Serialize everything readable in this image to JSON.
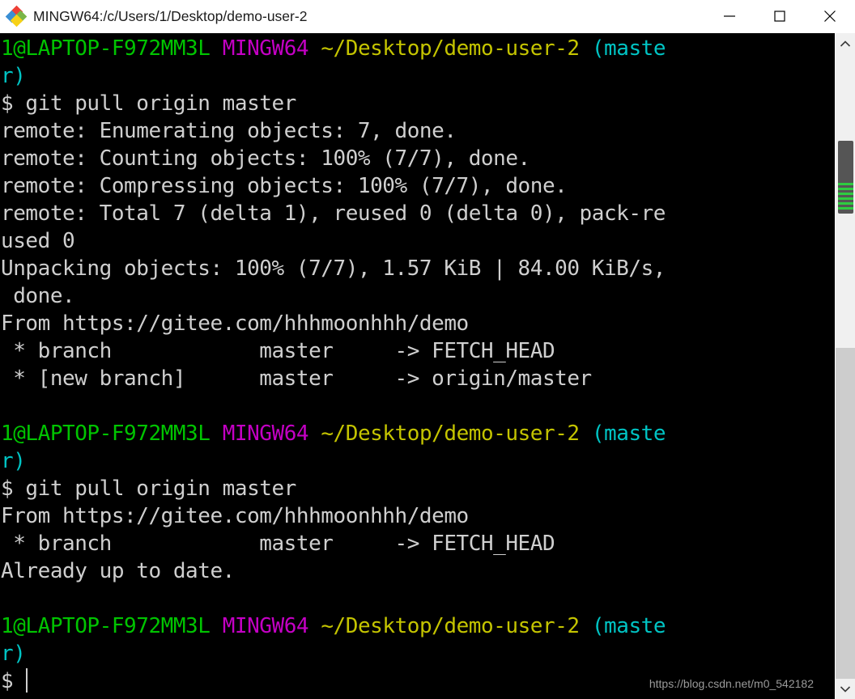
{
  "window": {
    "title": "MINGW64:/c/Users/1/Desktop/demo-user-2",
    "icon": "git-bash-diamond-icon",
    "controls": {
      "minimize": "minimize-icon",
      "maximize": "maximize-icon",
      "close": "close-icon"
    }
  },
  "theme": {
    "background": "#000000",
    "foreground": "#c8c8c8",
    "green": "#00c400",
    "magenta": "#c400c4",
    "yellow": "#c4c400",
    "cyan": "#00c4c4",
    "titlebar_bg": "#ffffff",
    "scrollbar_track": "#f0f0f0",
    "scrollbar_thumb": "#555555",
    "scrollbar_thumb_stripe": "#2ecc40"
  },
  "prompt": {
    "user_host": "1@LAPTOP-F972MM3L",
    "shell": "MINGW64",
    "path": "~/Desktop/demo-user-2",
    "branch_open": "(maste",
    "branch_wrap": "r)",
    "sigil": "$"
  },
  "terminal": {
    "lines": [
      {
        "id": "prompt-1-line-1",
        "segments": [
          {
            "text": "1@LAPTOP-F972MM3L",
            "color": "green"
          },
          {
            "text": " ",
            "color": "white"
          },
          {
            "text": "MINGW64",
            "color": "magenta"
          },
          {
            "text": " ",
            "color": "white"
          },
          {
            "text": "~/Desktop/demo-user-2",
            "color": "yellow"
          },
          {
            "text": " ",
            "color": "white"
          },
          {
            "text": "(maste",
            "color": "cyan"
          }
        ]
      },
      {
        "id": "prompt-1-line-2",
        "segments": [
          {
            "text": "r)",
            "color": "cyan"
          }
        ]
      },
      {
        "id": "command-1",
        "segments": [
          {
            "text": "$ git pull origin master",
            "color": "white"
          }
        ]
      },
      {
        "id": "output-enumerating",
        "segments": [
          {
            "text": "remote: Enumerating objects: 7, done.",
            "color": "white"
          }
        ]
      },
      {
        "id": "output-counting",
        "segments": [
          {
            "text": "remote: Counting objects: 100% (7/7), done.",
            "color": "white"
          }
        ]
      },
      {
        "id": "output-compressing",
        "segments": [
          {
            "text": "remote: Compressing objects: 100% (7/7), done.",
            "color": "white"
          }
        ]
      },
      {
        "id": "output-total-line-1",
        "segments": [
          {
            "text": "remote: Total 7 (delta 1), reused 0 (delta 0), pack-re",
            "color": "white"
          }
        ]
      },
      {
        "id": "output-total-line-2",
        "segments": [
          {
            "text": "used 0",
            "color": "white"
          }
        ]
      },
      {
        "id": "output-unpacking-line-1",
        "segments": [
          {
            "text": "Unpacking objects: 100% (7/7), 1.57 KiB | 84.00 KiB/s,",
            "color": "white"
          }
        ]
      },
      {
        "id": "output-unpacking-line-2",
        "segments": [
          {
            "text": " done.",
            "color": "white"
          }
        ]
      },
      {
        "id": "output-from-1",
        "segments": [
          {
            "text": "From https://gitee.com/hhhmoonhhh/demo",
            "color": "white"
          }
        ]
      },
      {
        "id": "output-branch-fetchhead-1",
        "segments": [
          {
            "text": " * branch            master     -> FETCH_HEAD",
            "color": "white"
          }
        ]
      },
      {
        "id": "output-new-branch",
        "segments": [
          {
            "text": " * [new branch]      master     -> origin/master",
            "color": "white"
          }
        ]
      },
      {
        "id": "blank-1",
        "segments": [
          {
            "text": "",
            "color": "white"
          }
        ]
      },
      {
        "id": "prompt-2-line-1",
        "segments": [
          {
            "text": "1@LAPTOP-F972MM3L",
            "color": "green"
          },
          {
            "text": " ",
            "color": "white"
          },
          {
            "text": "MINGW64",
            "color": "magenta"
          },
          {
            "text": " ",
            "color": "white"
          },
          {
            "text": "~/Desktop/demo-user-2",
            "color": "yellow"
          },
          {
            "text": " ",
            "color": "white"
          },
          {
            "text": "(maste",
            "color": "cyan"
          }
        ]
      },
      {
        "id": "prompt-2-line-2",
        "segments": [
          {
            "text": "r)",
            "color": "cyan"
          }
        ]
      },
      {
        "id": "command-2",
        "segments": [
          {
            "text": "$ git pull origin master",
            "color": "white"
          }
        ]
      },
      {
        "id": "output-from-2",
        "segments": [
          {
            "text": "From https://gitee.com/hhhmoonhhh/demo",
            "color": "white"
          }
        ]
      },
      {
        "id": "output-branch-fetchhead-2",
        "segments": [
          {
            "text": " * branch            master     -> FETCH_HEAD",
            "color": "white"
          }
        ]
      },
      {
        "id": "output-already-up-to-date",
        "segments": [
          {
            "text": "Already up to date.",
            "color": "white"
          }
        ]
      },
      {
        "id": "blank-2",
        "segments": [
          {
            "text": "",
            "color": "white"
          }
        ]
      },
      {
        "id": "prompt-3-line-1",
        "segments": [
          {
            "text": "1@LAPTOP-F972MM3L",
            "color": "green"
          },
          {
            "text": " ",
            "color": "white"
          },
          {
            "text": "MINGW64",
            "color": "magenta"
          },
          {
            "text": " ",
            "color": "white"
          },
          {
            "text": "~/Desktop/demo-user-2",
            "color": "yellow"
          },
          {
            "text": " ",
            "color": "white"
          },
          {
            "text": "(maste",
            "color": "cyan"
          }
        ]
      },
      {
        "id": "prompt-3-line-2",
        "segments": [
          {
            "text": "r)",
            "color": "cyan"
          }
        ]
      },
      {
        "id": "prompt-3-input",
        "segments": [
          {
            "text": "$",
            "color": "white"
          }
        ],
        "cursor": true
      }
    ]
  },
  "watermark": {
    "text": "https://blog.csdn.net/m0_542182"
  },
  "scrollbar": {
    "up_arrow": "chevron-up-icon",
    "down_arrow": "chevron-down-icon"
  }
}
